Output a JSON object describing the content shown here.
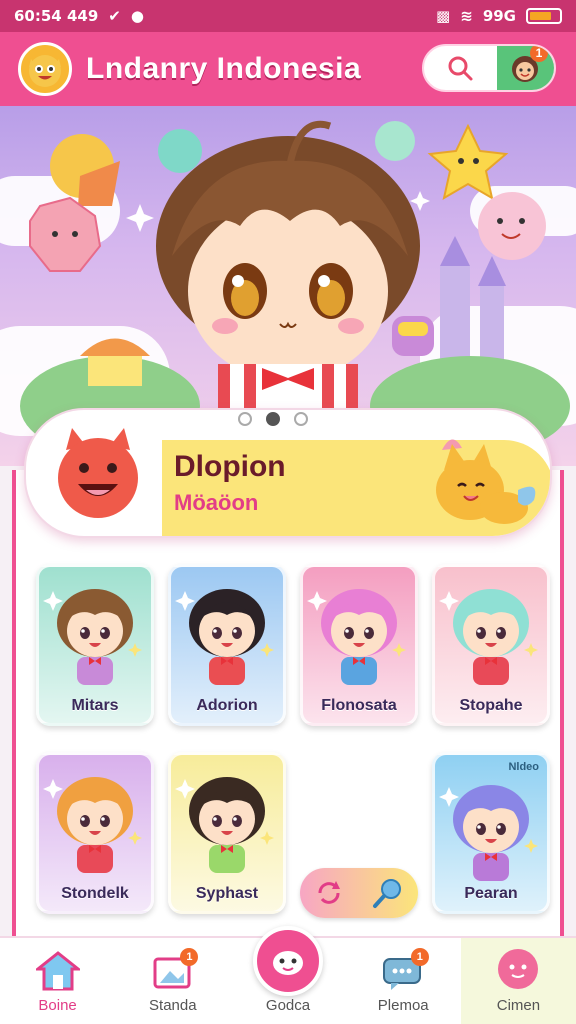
{
  "status_bar": {
    "time": "60:54 449",
    "battery_level": 0.75,
    "signal_text": "99G"
  },
  "header": {
    "title": "Lndanry Indonesia",
    "notification_count": "1"
  },
  "hero": {
    "pager_dots": 3,
    "active_dot": 1
  },
  "featured": {
    "title": "Dlopion",
    "subtitle": "Möaöon"
  },
  "cards": [
    {
      "label": "Mitars",
      "bg": "#9fe0cf",
      "hair": "#8a5a32",
      "outfit": "#c88ad8"
    },
    {
      "label": "Adorion",
      "bg": "#9cc8f2",
      "hair": "#2b2226",
      "outfit": "#ea4e52"
    },
    {
      "label": "Flonosata",
      "bg": "#f49ec0",
      "hair": "#e87fd4",
      "outfit": "#5aa4e0"
    },
    {
      "label": "Stopahe",
      "bg": "#f8c0cc",
      "hair": "#8fe0d4",
      "outfit": "#e84a58"
    },
    {
      "label": "Stondelk",
      "bg": "#d8b0ec",
      "hair": "#f0a040",
      "outfit": "#e84a58"
    },
    {
      "label": "Syphast",
      "bg": "#f7ec9a",
      "hair": "#3a2a22",
      "outfit": "#9ad86a"
    },
    {
      "label": "Pearan",
      "bg": "#8fd0f2",
      "hair": "#8a86e6",
      "outfit": "#b97ad8",
      "tag": "Nldeo"
    }
  ],
  "bottom_nav": [
    {
      "label": "Boine",
      "icon": "home-icon"
    },
    {
      "label": "Standa",
      "icon": "gallery-icon",
      "badge": "1"
    },
    {
      "label": "Godca",
      "icon": "mascot-icon"
    },
    {
      "label": "Plemoa",
      "icon": "message-icon",
      "badge": "1"
    },
    {
      "label": "Cimen",
      "icon": "profile-icon"
    }
  ],
  "colors": {
    "primary": "#ef4f91",
    "accent_yellow": "#fbe57a",
    "status_bar": "#c8346f"
  }
}
